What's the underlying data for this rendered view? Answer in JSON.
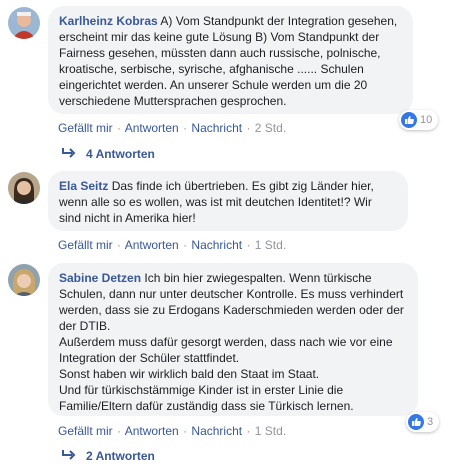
{
  "comments": [
    {
      "author": "Karlheinz Kobras",
      "text": " A) Vom Standpunkt der Integration gesehen, erscheint mir das keine gute Lösung B) Vom Standpunkt der Fairness gesehen, müssten dann auch russische, polnische, kroatische, serbische, syrische, afghanische ...... Schulen eingerichtet werden. An unserer Schule werden um die 20 verschiedene Muttersprachen gesprochen.",
      "like": "Gefällt mir",
      "reply": "Antworten",
      "message": "Nachricht",
      "time": "2 Std.",
      "reaction_count": "10",
      "replies_label": "4 Antworten"
    },
    {
      "author": "Ela Seitz",
      "text": " Das finde ich übertrieben. Es gibt zig Länder hier, wenn alle so es wollen, was ist mit deutchen Identitet!? Wir sind nicht in Amerika hier!",
      "like": "Gefällt mir",
      "reply": "Antworten",
      "message": "Nachricht",
      "time": "1 Std."
    },
    {
      "author": "Sabine Detzen",
      "text": " Ich bin hier zwiegespalten. Wenn türkische Schulen, dann nur unter deutscher Kontrolle. Es muss verhindert werden, dass sie zu Erdogans Kaderschmieden werden oder der der DTIB.\nAußerdem muss dafür gesorgt werden, dass nach wie vor eine Integration der Schüler stattfindet.\nSonst haben wir wirklich bald den Staat im Staat.\nUnd für türkischstämmige Kinder ist in erster Linie die Familie/Eltern dafür zuständig dass sie Türkisch lernen.",
      "like": "Gefällt mir",
      "reply": "Antworten",
      "message": "Nachricht",
      "time": "1 Std.",
      "reaction_count": "3",
      "replies_label": "2 Antworten"
    }
  ],
  "separator": "·",
  "colors": {
    "link": "#385898",
    "bubble": "#f2f3f5",
    "like": "#3578e5"
  }
}
